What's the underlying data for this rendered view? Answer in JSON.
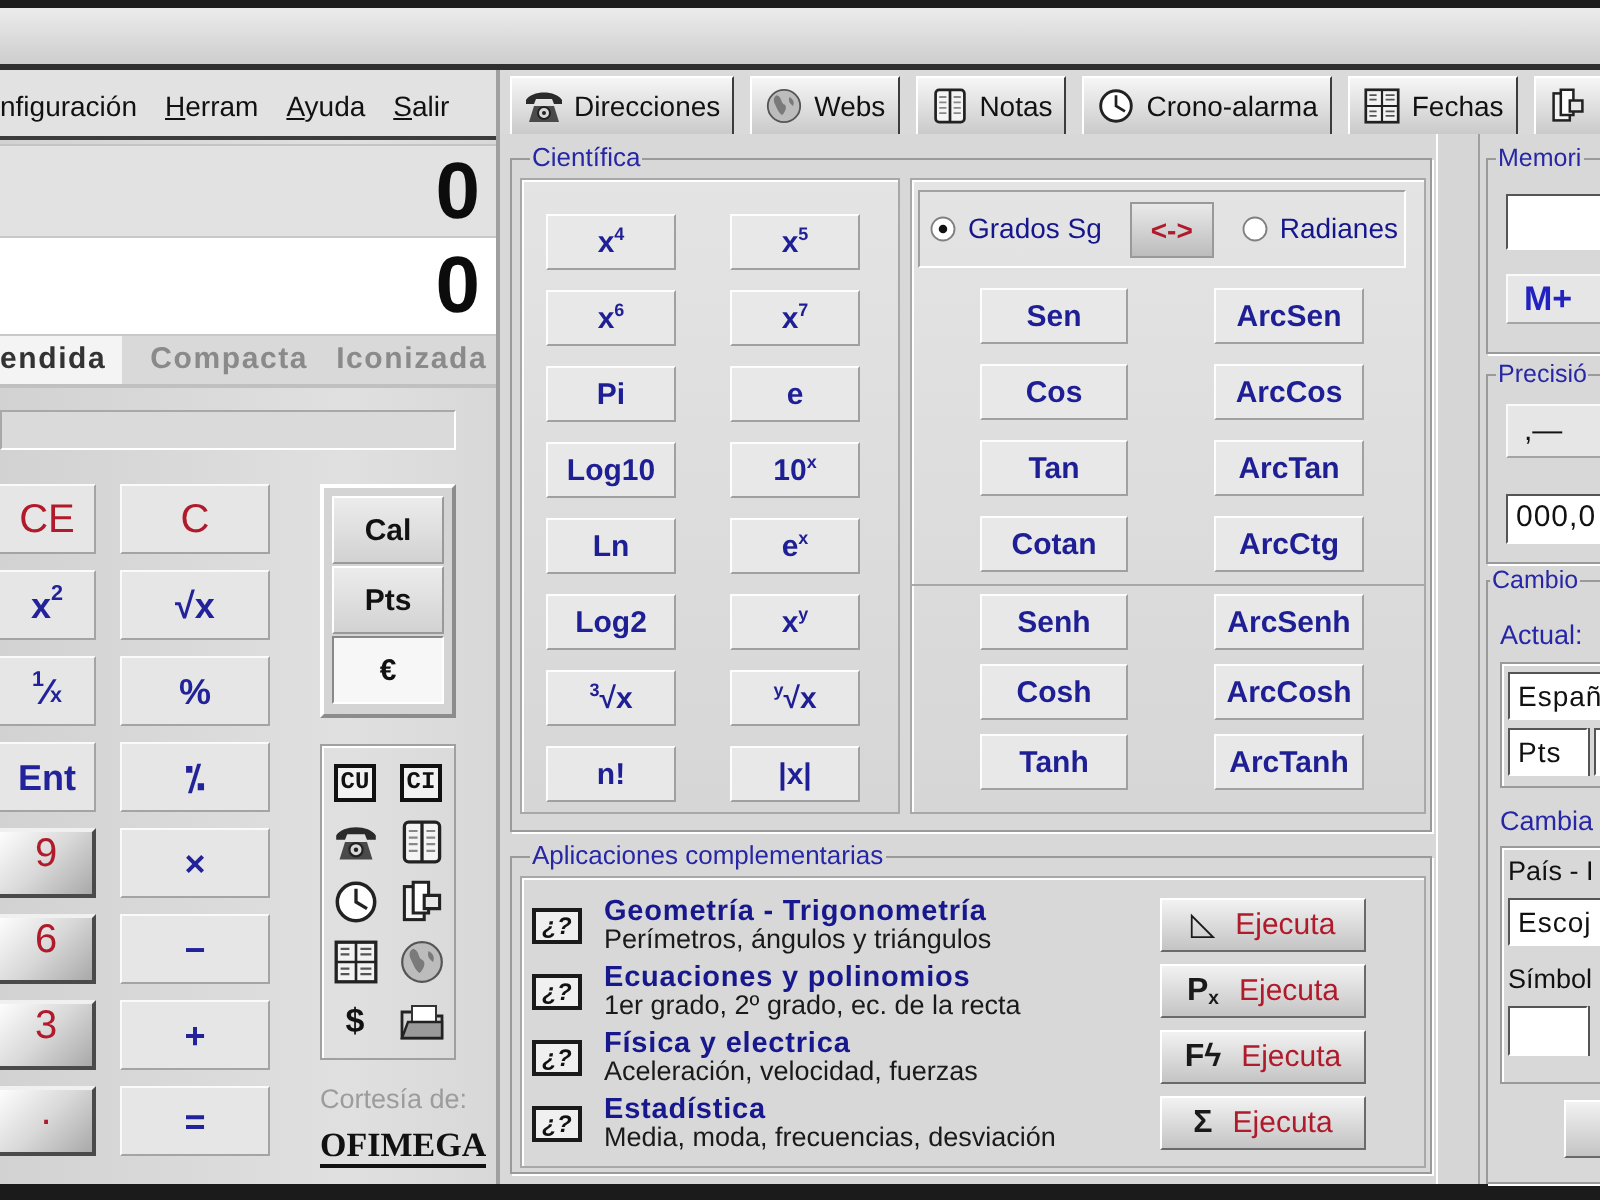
{
  "menu": [
    {
      "label": "nfiguración",
      "mnemonic_underlined": false
    },
    {
      "label": "Herram",
      "mnemonic_underlined": true
    },
    {
      "label": "Ayuda",
      "mnemonic_underlined": true
    },
    {
      "label": "Salir",
      "mnemonic_underlined": true
    }
  ],
  "display": {
    "memory_line": "0",
    "entry_line": "0"
  },
  "view_tabs": [
    {
      "label": "endida",
      "selected": true
    },
    {
      "label": "Compacta",
      "selected": false
    },
    {
      "label": "Iconizada",
      "selected": false
    }
  ],
  "keypad": [
    {
      "label": "CE",
      "kind": "clear"
    },
    {
      "label": "C",
      "kind": "clear"
    },
    {
      "label": "x$^{2}$",
      "kind": "op"
    },
    {
      "label": "√x",
      "kind": "op"
    },
    {
      "label": "$^{1}$⁄$_{x}$",
      "kind": "op"
    },
    {
      "label": "%",
      "kind": "op"
    },
    {
      "label": "Ent",
      "kind": "op"
    },
    {
      "label": "⁒",
      "kind": "op"
    },
    {
      "label": "9",
      "kind": "digit"
    },
    {
      "label": "×",
      "kind": "op"
    },
    {
      "label": "6",
      "kind": "digit"
    },
    {
      "label": "−",
      "kind": "op"
    },
    {
      "label": "3",
      "kind": "digit"
    },
    {
      "label": "+",
      "kind": "op"
    },
    {
      "label": ".",
      "kind": "digit"
    },
    {
      "label": "=",
      "kind": "op"
    }
  ],
  "mode_buttons": [
    {
      "label": "Cal",
      "selected": false
    },
    {
      "label": "Pts",
      "selected": false
    },
    {
      "label": "€",
      "selected": true
    }
  ],
  "tools": [
    {
      "kind": "boxed",
      "label": "CU"
    },
    {
      "kind": "boxed",
      "label": "CI"
    },
    {
      "kind": "phone"
    },
    {
      "kind": "notebook"
    },
    {
      "kind": "clock"
    },
    {
      "kind": "clipboard"
    },
    {
      "kind": "calendar"
    },
    {
      "kind": "globe"
    },
    {
      "kind": "glyph",
      "label": "$"
    },
    {
      "kind": "folder"
    }
  ],
  "credit": {
    "text": "Cortesía de:",
    "logo": "OFIMEGA"
  },
  "tabs": [
    {
      "label": "Direcciones",
      "selected": false
    },
    {
      "label": "Webs",
      "selected": false
    },
    {
      "label": "Notas",
      "selected": false
    },
    {
      "label": "Crono-alarma",
      "selected": false
    },
    {
      "label": "Fechas",
      "selected": false
    },
    {
      "selected": false
    }
  ],
  "scientific": {
    "title": "Científica",
    "functions": [
      "x$^{4}$",
      "x$^{5}$",
      "x$^{6}$",
      "x$^{7}$",
      "Pi",
      "e",
      "Log10",
      "10$^{x}$",
      "Ln",
      "e$^{x}$",
      "Log2",
      "x$^{y}$",
      "$^{3}$√x",
      "$^{y}$√x",
      "n!",
      "|x|"
    ],
    "angle_modes": [
      {
        "label": "Grados Sg",
        "selected": true
      },
      {
        "label": "Radianes",
        "selected": false
      }
    ],
    "swap_button": "<->",
    "trig": [
      "Sen",
      "ArcSen",
      "Cos",
      "ArcCos",
      "Tan",
      "ArcTan",
      "Cotan",
      "ArcCtg"
    ],
    "hyperbolic": [
      "Senh",
      "ArcSenh",
      "Cosh",
      "ArcCosh",
      "Tanh",
      "ArcTanh"
    ]
  },
  "applications": {
    "title": "Aplicaciones complementarias",
    "items": [
      {
        "help": "¿?",
        "title": "Geometría - Trigonometría",
        "description": "Perímetros, ángulos y triángulos",
        "glyph": "◺",
        "button": "Ejecuta"
      },
      {
        "help": "¿?",
        "title": "Ecuaciones y polinomios",
        "description": "1er grado, 2º grado, ec. de la recta",
        "glyph": "P$_{x}$",
        "button": "Ejecuta"
      },
      {
        "help": "¿?",
        "title": "Física y electrica",
        "description": "Aceleración, velocidad, fuerzas",
        "glyph": "Fϟ",
        "button": "Ejecuta"
      },
      {
        "help": "¿?",
        "title": "Estadística",
        "description": "Media, moda, frecuencias, desviación",
        "glyph": "Σ",
        "button": "Ejecuta"
      }
    ]
  },
  "memory": {
    "title": "Memori",
    "button": "M+"
  },
  "precision": {
    "title": "Precisió",
    "button": ",—",
    "value": "000,0"
  },
  "exchange": {
    "title": "Cambio",
    "current_label": "Actual:",
    "country": "Españ",
    "currency": "Pts",
    "change_label": "Cambia",
    "country_label": "País - I",
    "country_choice": "Escoj",
    "symbol_label": "Símbol"
  }
}
